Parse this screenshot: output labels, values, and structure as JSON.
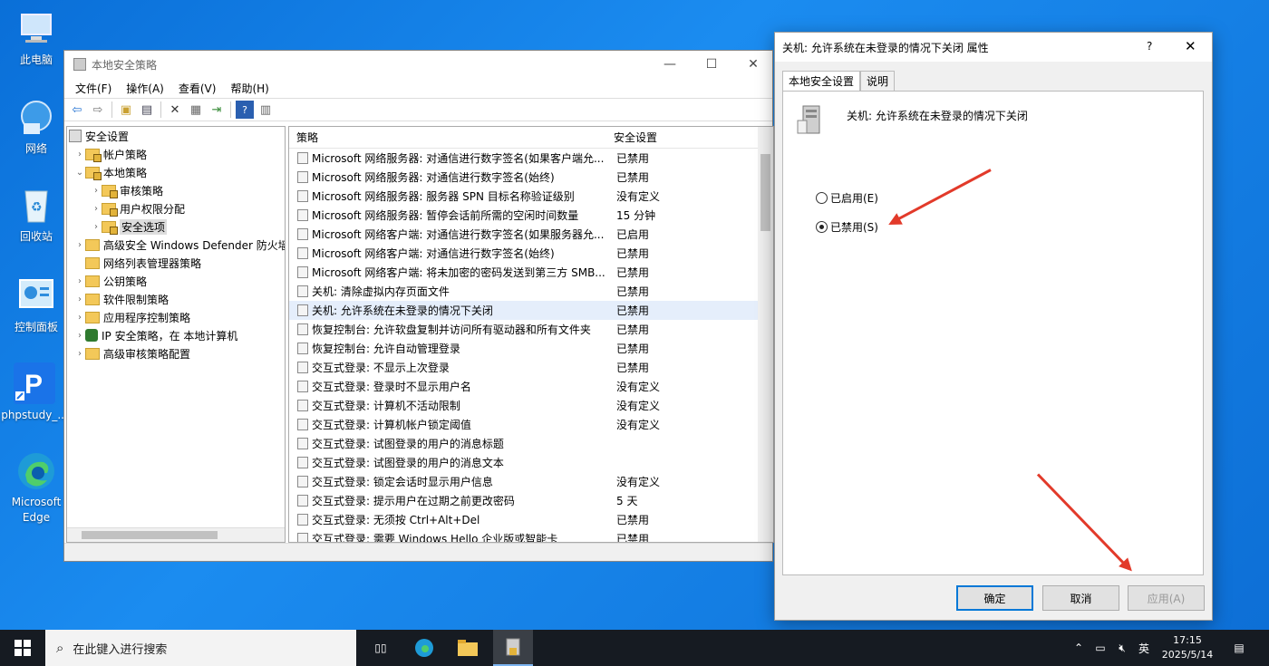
{
  "desktop_icons": [
    {
      "label": "此电脑",
      "icon": "computer-icon"
    },
    {
      "label": "网络",
      "icon": "network-icon"
    },
    {
      "label": "回收站",
      "icon": "recycle-bin-icon"
    },
    {
      "label": "控制面板",
      "icon": "control-panel-icon"
    },
    {
      "label": "phpstudy_...",
      "icon": "phpstudy-icon"
    },
    {
      "label": "Microsoft Edge",
      "icon": "edge-icon"
    }
  ],
  "main_window": {
    "title": "本地安全策略",
    "menu": [
      "文件(F)",
      "操作(A)",
      "查看(V)",
      "帮助(H)"
    ],
    "tree": [
      {
        "label": "安全设置",
        "exp": "",
        "level": 0
      },
      {
        "label": "帐户策略",
        "exp": "›",
        "level": 1
      },
      {
        "label": "本地策略",
        "exp": "⌄",
        "level": 1
      },
      {
        "label": "审核策略",
        "exp": "›",
        "level": 2
      },
      {
        "label": "用户权限分配",
        "exp": "›",
        "level": 2
      },
      {
        "label": "安全选项",
        "exp": "›",
        "level": 2
      },
      {
        "label": "高级安全 Windows Defender 防火墙",
        "exp": "›",
        "level": 1
      },
      {
        "label": "网络列表管理器策略",
        "exp": "",
        "level": 1
      },
      {
        "label": "公钥策略",
        "exp": "›",
        "level": 1
      },
      {
        "label": "软件限制策略",
        "exp": "›",
        "level": 1
      },
      {
        "label": "应用程序控制策略",
        "exp": "›",
        "level": 1
      },
      {
        "label": "IP 安全策略，在 本地计算机",
        "exp": "›",
        "level": 1
      },
      {
        "label": "高级审核策略配置",
        "exp": "›",
        "level": 1
      }
    ],
    "columns": {
      "policy": "策略",
      "setting": "安全设置"
    },
    "rows": [
      {
        "policy": "Microsoft 网络服务器: 对通信进行数字签名(如果客户端允...",
        "setting": "已禁用"
      },
      {
        "policy": "Microsoft 网络服务器: 对通信进行数字签名(始终)",
        "setting": "已禁用"
      },
      {
        "policy": "Microsoft 网络服务器: 服务器 SPN 目标名称验证级别",
        "setting": "没有定义"
      },
      {
        "policy": "Microsoft 网络服务器: 暂停会话前所需的空闲时间数量",
        "setting": "15 分钟"
      },
      {
        "policy": "Microsoft 网络客户端: 对通信进行数字签名(如果服务器允...",
        "setting": "已启用"
      },
      {
        "policy": "Microsoft 网络客户端: 对通信进行数字签名(始终)",
        "setting": "已禁用"
      },
      {
        "policy": "Microsoft 网络客户端: 将未加密的密码发送到第三方 SMB...",
        "setting": "已禁用"
      },
      {
        "policy": "关机: 清除虚拟内存页面文件",
        "setting": "已禁用"
      },
      {
        "policy": "关机: 允许系统在未登录的情况下关闭",
        "setting": "已禁用"
      },
      {
        "policy": "恢复控制台: 允许软盘复制并访问所有驱动器和所有文件夹",
        "setting": "已禁用"
      },
      {
        "policy": "恢复控制台: 允许自动管理登录",
        "setting": "已禁用"
      },
      {
        "policy": "交互式登录: 不显示上次登录",
        "setting": "已禁用"
      },
      {
        "policy": "交互式登录: 登录时不显示用户名",
        "setting": "没有定义"
      },
      {
        "policy": "交互式登录: 计算机不活动限制",
        "setting": "没有定义"
      },
      {
        "policy": "交互式登录: 计算机帐户锁定阈值",
        "setting": "没有定义"
      },
      {
        "policy": "交互式登录: 试图登录的用户的消息标题",
        "setting": ""
      },
      {
        "policy": "交互式登录: 试图登录的用户的消息文本",
        "setting": ""
      },
      {
        "policy": "交互式登录: 锁定会话时显示用户信息",
        "setting": "没有定义"
      },
      {
        "policy": "交互式登录: 提示用户在过期之前更改密码",
        "setting": "5 天"
      },
      {
        "policy": "交互式登录: 无须按 Ctrl+Alt+Del",
        "setting": "已禁用"
      },
      {
        "policy": "交互式登录: 需要 Windows Hello 企业版或智能卡",
        "setting": "已禁用"
      }
    ],
    "selected_row_index": 8
  },
  "dialog": {
    "title": "关机: 允许系统在未登录的情况下关闭 属性",
    "help": "?",
    "tabs": [
      "本地安全设置",
      "说明"
    ],
    "policy_name": "关机: 允许系统在未登录的情况下关闭",
    "options": [
      {
        "label": "已启用(E)",
        "checked": false
      },
      {
        "label": "已禁用(S)",
        "checked": true
      }
    ],
    "buttons": {
      "ok": "确定",
      "cancel": "取消",
      "apply": "应用(A)"
    }
  },
  "taskbar": {
    "search_placeholder": "在此键入进行搜索",
    "ime": "英",
    "time": "17:15",
    "date": "2025/5/14"
  },
  "colors": {
    "desktop": "#0a6fd8",
    "accent": "#0078d7",
    "annotation_arrow": "#e23a2a",
    "taskbar": "#161b22"
  }
}
